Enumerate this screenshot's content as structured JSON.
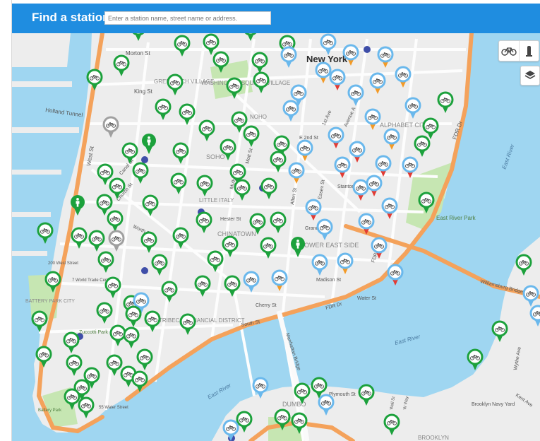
{
  "header": {
    "title": "Find a station",
    "search_placeholder": "Enter a station name, street name or address."
  },
  "controls": {
    "bike_toggle_icon": "bicycle-icon",
    "dock_toggle_icon": "dock-icon",
    "layers_icon": "layers-icon"
  },
  "map": {
    "colors": {
      "water": "#9fd6f1",
      "land": "#ededed",
      "park": "#c6e6b2",
      "highway": "#f4a25b",
      "avenue": "#fdfdfd",
      "header": "#1f8de0",
      "pin_green": "#1ca13c",
      "pin_blue": "#6ab8ec",
      "pin_orange": "#f39a26",
      "pin_red": "#e23b33",
      "pin_gray": "#a0a0a0"
    },
    "labels": [
      "New York",
      "Morton St",
      "King St",
      "Holland Tunnel",
      "GREENWICH VILLAGE",
      "WASHINGTON SQUARE VILLAGE",
      "NOHO",
      "E 2nd St",
      "1st Ave",
      "Avenue A",
      "ALPHABET CITY",
      "FDR Dr",
      "East River",
      "West St",
      "SOHO",
      "Mulberry St",
      "Mott St",
      "Allen St",
      "Essex St",
      "Stanton",
      "Canal St",
      "Church St",
      "LITTLE ITALY",
      "Worth St",
      "Hester St",
      "CHINATOWN",
      "LOWER EAST SIDE",
      "Grand St",
      "East River Park",
      "Madison St",
      "Water St",
      "FDR Dr",
      "Williamsburg Bridge",
      "200 West Street",
      "7 World Trade Center",
      "BATTERY PARK CITY",
      "Zuccotti Park",
      "TRIBECA / FINANCIAL DISTRICT",
      "Cherry St",
      "South St",
      "FDR Dr",
      "East River",
      "Manhattan Bridge",
      "East River",
      "Battery Park",
      "55 Water Street",
      "DUMBO",
      "Plymouth St",
      "Wythe Ave",
      "Kent Ave",
      "Brooklyn Navy Yard",
      "BROOKLYN",
      "Wall St",
      "W Way"
    ]
  }
}
